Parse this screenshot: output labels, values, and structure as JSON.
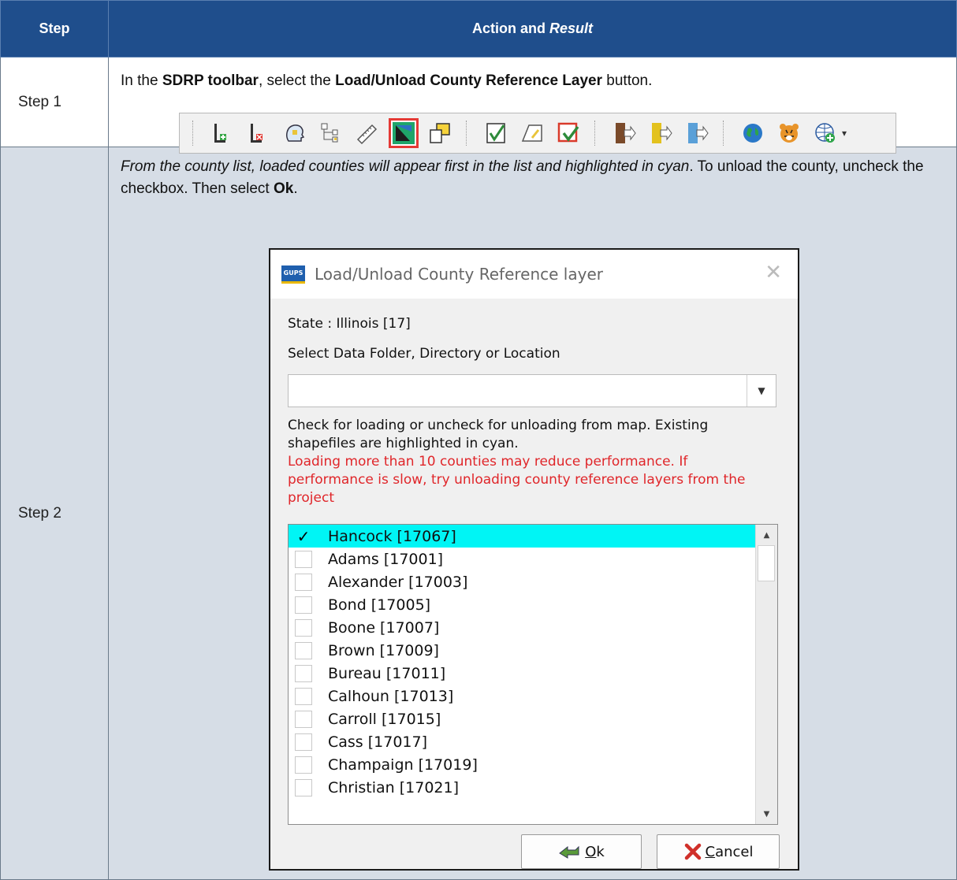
{
  "table": {
    "header_step": "Step",
    "header_action": "Action and",
    "header_result": "Result"
  },
  "step1": {
    "label": "Step 1",
    "desc_pre": "In the ",
    "desc_b1": "SDRP toolbar",
    "desc_mid": ", select the ",
    "desc_b2": "Load/Unload County Reference Layer",
    "desc_post": " button."
  },
  "toolbar": {
    "icons": [
      "add-layer-icon",
      "remove-layer-icon",
      "head-profile-icon",
      "tree-structure-icon",
      "ruler-icon",
      "load-county-reference-icon",
      "overlap-squares-icon",
      "check-square-icon",
      "shape-edit-icon",
      "review-check-icon",
      "export-icon",
      "export-yellow-icon",
      "export-blue-icon",
      "globe-icon",
      "tiger-icon",
      "add-globe-icon"
    ]
  },
  "step2": {
    "label": "Step 2",
    "desc_italic": "From the county list, loaded counties will appear first in the list and highlighted in cyan",
    "desc_rest": ". To unload the county, uncheck the checkbox. Then select ",
    "desc_b": "Ok",
    "desc_end": "."
  },
  "dialog": {
    "logo": "GUPS",
    "title": "Load/Unload County Reference layer",
    "state": "State : Illinois [17]",
    "folder_label": "Select Data Folder, Directory or Location",
    "combo_value": "",
    "note": "Check for loading or uncheck for unloading from map. Existing shapefiles are highlighted in cyan.",
    "warning": "Loading more than 10 counties may reduce performance. If performance is slow, try unloading county reference layers from the project",
    "counties": [
      {
        "label": "Hancock [17067]",
        "checked": true,
        "highlighted": true
      },
      {
        "label": "Adams [17001]",
        "checked": false
      },
      {
        "label": "Alexander [17003]",
        "checked": false
      },
      {
        "label": "Bond [17005]",
        "checked": false
      },
      {
        "label": "Boone [17007]",
        "checked": false
      },
      {
        "label": "Brown [17009]",
        "checked": false
      },
      {
        "label": "Bureau [17011]",
        "checked": false
      },
      {
        "label": "Calhoun [17013]",
        "checked": false
      },
      {
        "label": "Carroll [17015]",
        "checked": false
      },
      {
        "label": "Cass [17017]",
        "checked": false
      },
      {
        "label": "Champaign [17019]",
        "checked": false
      },
      {
        "label": "Christian [17021]",
        "checked": false
      }
    ],
    "ok_label": "Ok",
    "ok_mnemonic": "O",
    "cancel_label": "Cancel",
    "cancel_mnemonic": "C"
  }
}
